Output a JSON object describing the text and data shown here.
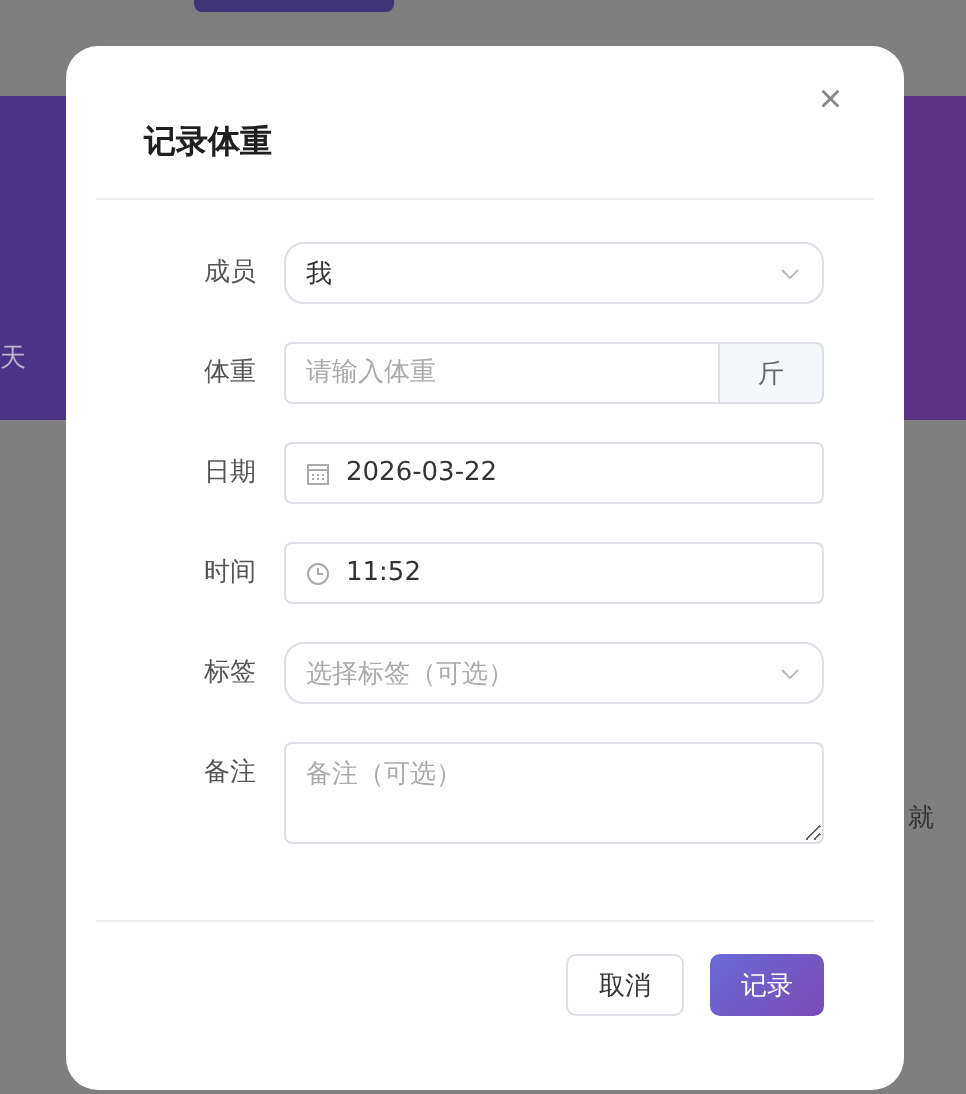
{
  "background": {
    "left_fragment": "天",
    "right_fragment": "就"
  },
  "dialog": {
    "title": "记录体重",
    "close": "×",
    "fields": [
      {
        "kind": "select",
        "label": "成员",
        "value": "我"
      },
      {
        "kind": "addon",
        "label": "体重",
        "placeholder": "请输入体重",
        "addon": "斤"
      },
      {
        "kind": "date",
        "label": "日期",
        "value": "2026-03-22"
      },
      {
        "kind": "time",
        "label": "时间",
        "value": "11:52"
      },
      {
        "kind": "select",
        "label": "标签",
        "placeholder": "选择标签（可选）"
      },
      {
        "kind": "textarea",
        "label": "备注",
        "placeholder": "备注（可选）"
      }
    ],
    "buttons": [
      {
        "label": "取消",
        "primary": false
      },
      {
        "label": "记录",
        "primary": true
      }
    ]
  }
}
